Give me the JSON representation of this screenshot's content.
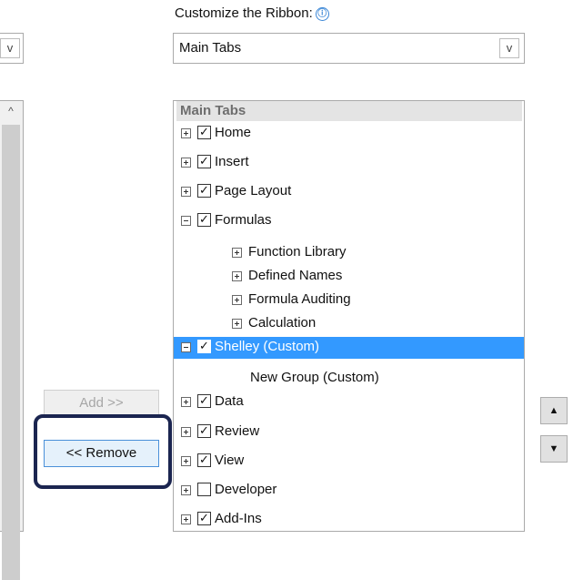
{
  "header": {
    "customize_label": "Customize the Ribbon:",
    "info_icon": "ⓘ"
  },
  "main_dropdown": {
    "value": "Main Tabs",
    "arrow": "v"
  },
  "left_dropdown": {
    "arrow": "v"
  },
  "left_list": {
    "scroll_up_glyph": "^"
  },
  "buttons": {
    "add_label": "Add >>",
    "remove_label": "<< Remove"
  },
  "move": {
    "up_glyph": "▲",
    "down_glyph": "▼"
  },
  "tree": {
    "header": "Main Tabs",
    "items": [
      {
        "label": "Home",
        "checked": true,
        "expander": "plus"
      },
      {
        "label": "Insert",
        "checked": true,
        "expander": "plus"
      },
      {
        "label": "Page Layout",
        "checked": true,
        "expander": "plus"
      },
      {
        "label": "Formulas",
        "checked": true,
        "expander": "minus"
      },
      {
        "label": "Function Library",
        "expander": "plus"
      },
      {
        "label": "Defined Names",
        "expander": "plus"
      },
      {
        "label": "Formula Auditing",
        "expander": "plus"
      },
      {
        "label": "Calculation",
        "expander": "plus"
      },
      {
        "label": "Shelley (Custom)",
        "checked": true,
        "expander": "minus",
        "selected": true
      },
      {
        "label": "New Group (Custom)"
      },
      {
        "label": "Data",
        "checked": true,
        "expander": "plus"
      },
      {
        "label": "Review",
        "checked": true,
        "expander": "plus"
      },
      {
        "label": "View",
        "checked": true,
        "expander": "plus"
      },
      {
        "label": "Developer",
        "checked": false,
        "expander": "plus"
      },
      {
        "label": "Add-Ins",
        "checked": true,
        "expander": "plus"
      }
    ],
    "check_glyph": "✓"
  },
  "colors": {
    "selection": "#3399ff",
    "focus_ring": "#1b2550"
  }
}
